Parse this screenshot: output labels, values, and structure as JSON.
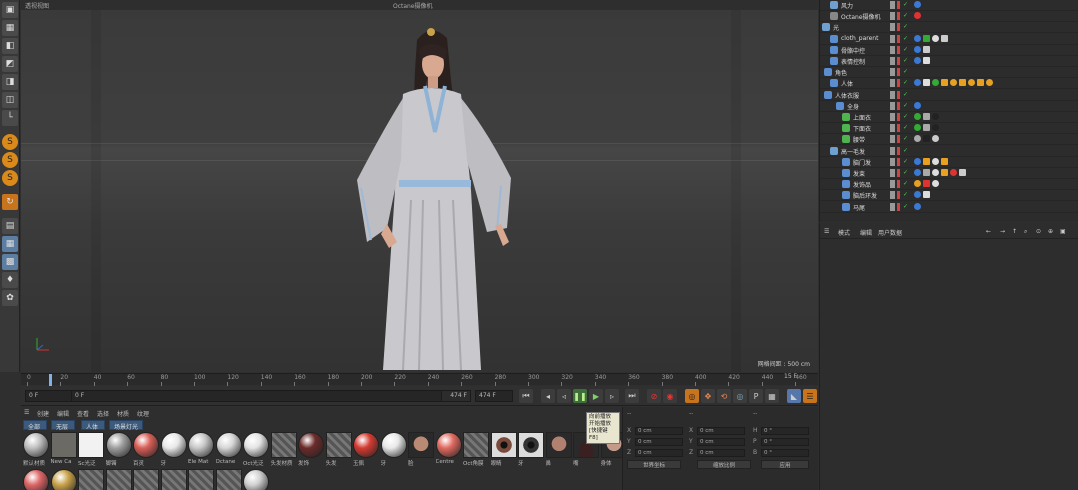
{
  "viewport": {
    "title": "透视视图",
    "camera_label": "Octane摄像机",
    "grid_info": "网格间距 : 500 cm"
  },
  "timeline": {
    "ruler_ticks": [
      "0",
      "20",
      "40",
      "60",
      "80",
      "100",
      "120",
      "140",
      "160",
      "180",
      "200",
      "220",
      "240",
      "260",
      "280",
      "300",
      "320",
      "340",
      "360",
      "380",
      "400",
      "420",
      "440",
      "460"
    ],
    "end_label": "15 F",
    "current_frame": "0 F",
    "start_field": "0 F",
    "end_field": "474 F",
    "end_field2": "474 F"
  },
  "tooltip": {
    "lines": [
      "向前播放",
      "开始播放",
      "[快捷键 F8]"
    ]
  },
  "material_manager": {
    "menu": [
      "创建",
      "编辑",
      "查看",
      "选择",
      "材质",
      "纹理"
    ],
    "tabs": [
      "全部",
      "无层",
      "人体",
      "场景灯光"
    ],
    "materials": [
      {
        "label": "默认材质",
        "kind": "sphere",
        "color": "#bfbfbf"
      },
      {
        "label": "New Ca",
        "kind": "square",
        "color": "#6b6a64"
      },
      {
        "label": "Sc光泛",
        "kind": "square",
        "color": "#f2f2f2"
      },
      {
        "label": "脚镯",
        "kind": "sphere",
        "color": "#9f9f9f"
      },
      {
        "label": "百灵",
        "kind": "sphere",
        "color": "#d85e57"
      },
      {
        "label": "牙",
        "kind": "sphere",
        "color": "#e8e8e8"
      },
      {
        "label": "Ele Mat",
        "kind": "sphere",
        "color": "#c8c8c8"
      },
      {
        "label": "Octane",
        "kind": "sphere",
        "color": "#d6d6d6"
      },
      {
        "label": "Oct光泛",
        "kind": "sphere",
        "color": "#e4e4e4"
      },
      {
        "label": "头发材质",
        "kind": "check",
        "color": "#666"
      },
      {
        "label": "发饰",
        "kind": "sphere",
        "color": "#6b2b2a"
      },
      {
        "label": "头发",
        "kind": "check",
        "color": "#666"
      },
      {
        "label": "玉佩",
        "kind": "sphere",
        "color": "#d43b32"
      },
      {
        "label": "牙",
        "kind": "sphere",
        "color": "#e8e8e8"
      },
      {
        "label": "脸",
        "kind": "face",
        "color": "#b98a74"
      },
      {
        "label": "Centre",
        "kind": "sphere",
        "color": "#e06a60"
      },
      {
        "label": "Oct角膜",
        "kind": "check",
        "color": "#666"
      },
      {
        "label": "眼睛",
        "kind": "eye",
        "color": "#7a4b3a"
      },
      {
        "label": "牙",
        "kind": "eye",
        "color": "#333"
      },
      {
        "label": "鼻",
        "kind": "face",
        "color": "#b08070"
      },
      {
        "label": "嘴",
        "kind": "cone",
        "color": "#3a2020"
      },
      {
        "label": "身体",
        "kind": "face",
        "color": "#c49a88"
      }
    ],
    "row2": [
      {
        "label": "",
        "kind": "sphere",
        "color": "#d66"
      },
      {
        "label": "",
        "kind": "sphere",
        "color": "#c9a24a"
      },
      {
        "label": "",
        "kind": "check",
        "color": "#666"
      },
      {
        "label": "",
        "kind": "check",
        "color": "#666"
      },
      {
        "label": "",
        "kind": "check",
        "color": "#666"
      },
      {
        "label": "",
        "kind": "check",
        "color": "#666"
      },
      {
        "label": "",
        "kind": "check",
        "color": "#666"
      },
      {
        "label": "",
        "kind": "check",
        "color": "#666"
      },
      {
        "label": "",
        "kind": "sphere",
        "color": "#d0d0d0"
      }
    ]
  },
  "coordinates": {
    "head": [
      "--",
      "--",
      "--"
    ],
    "rows": [
      {
        "a": "X",
        "av": "0 cm",
        "b": "X",
        "bv": "0 cm",
        "c": "H",
        "cv": "0 °"
      },
      {
        "a": "Y",
        "av": "0 cm",
        "b": "Y",
        "bv": "0 cm",
        "c": "P",
        "cv": "0 °"
      },
      {
        "a": "Z",
        "av": "0 cm",
        "b": "Z",
        "bv": "0 cm",
        "c": "B",
        "cv": "0 °"
      }
    ],
    "mode1": "世界坐标",
    "mode2": "缩放比例",
    "apply": "应用"
  },
  "object_manager": {
    "rows": [
      {
        "name": "风力",
        "indent": 10,
        "icon": "ico"
      },
      {
        "name": "Octane摄像机",
        "indent": 10,
        "icon": "cam"
      },
      {
        "name": "光",
        "indent": 2,
        "icon": "ico"
      },
      {
        "name": "cloth_parent",
        "indent": 10,
        "icon": "null"
      },
      {
        "name": "骨骼中控",
        "indent": 10,
        "icon": "null"
      },
      {
        "name": "表情控制",
        "indent": 10,
        "icon": "null"
      },
      {
        "name": "角色",
        "indent": 4,
        "icon": "null"
      },
      {
        "name": "人体",
        "indent": 10,
        "icon": "null"
      },
      {
        "name": "人体衣服",
        "indent": 4,
        "icon": "null"
      },
      {
        "name": "全身",
        "indent": 16,
        "icon": "null"
      },
      {
        "name": "上面衣",
        "indent": 22,
        "icon": "poly"
      },
      {
        "name": "下面衣",
        "indent": 22,
        "icon": "poly"
      },
      {
        "name": "腰带",
        "indent": 22,
        "icon": "poly"
      },
      {
        "name": "高一毛发",
        "indent": 10,
        "icon": "ico"
      },
      {
        "name": "脑门发",
        "indent": 22,
        "icon": "null"
      },
      {
        "name": "发束",
        "indent": 22,
        "icon": "null"
      },
      {
        "name": "发饰品",
        "indent": 22,
        "icon": "null"
      },
      {
        "name": "脑后环发",
        "indent": 22,
        "icon": "null"
      },
      {
        "name": "马尾",
        "indent": 22,
        "icon": "null"
      }
    ]
  },
  "attributes": {
    "menu": [
      "模式",
      "编辑",
      "用户数据"
    ]
  }
}
